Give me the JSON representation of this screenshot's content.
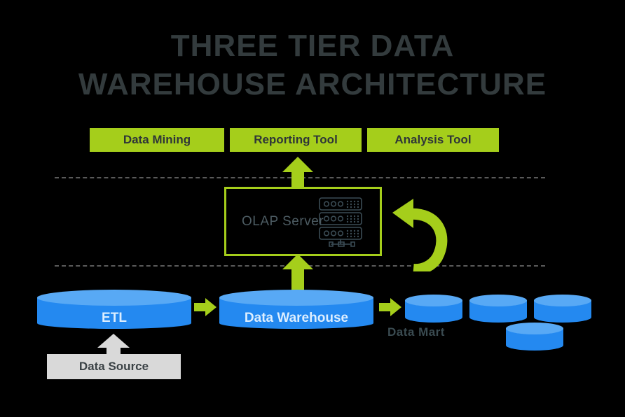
{
  "title": {
    "line1": "THREE TIER DATA",
    "line2": "WAREHOUSE ARCHITECTURE",
    "color": "#333b3d"
  },
  "top_tier": {
    "tools": [
      {
        "label": "Data Mining"
      },
      {
        "label": "Reporting Tool"
      },
      {
        "label": "Analysis Tool"
      }
    ]
  },
  "middle_tier": {
    "olap": {
      "label": "OLAP Server",
      "icon": "server-rack-icon",
      "border_color": "#a5ce1b",
      "text_color": "#4d5c63"
    },
    "feedback_arrow": {
      "icon": "curved-refresh-arrow-icon",
      "color": "#a5ce1b"
    }
  },
  "bottom_tier": {
    "etl": {
      "label": "ETL"
    },
    "data_warehouse": {
      "label": "Data Warehouse"
    },
    "data_mart": {
      "label": "Data Mart",
      "count": 4
    },
    "data_source": {
      "label": "Data Source"
    }
  },
  "arrows": {
    "olap_to_tools": "arrow-up-icon",
    "dw_to_olap": "arrow-up-icon",
    "etl_to_dw": "arrow-right-icon",
    "dw_to_mart": "arrow-right-icon",
    "source_to_etl": "arrow-up-icon"
  },
  "colors": {
    "background": "#000000",
    "green": "#a5ce1b",
    "blue_body": "#2489f0",
    "blue_top": "#58a9f5",
    "gray_box": "#d9d9d9",
    "divider": "#5a5a5a"
  }
}
